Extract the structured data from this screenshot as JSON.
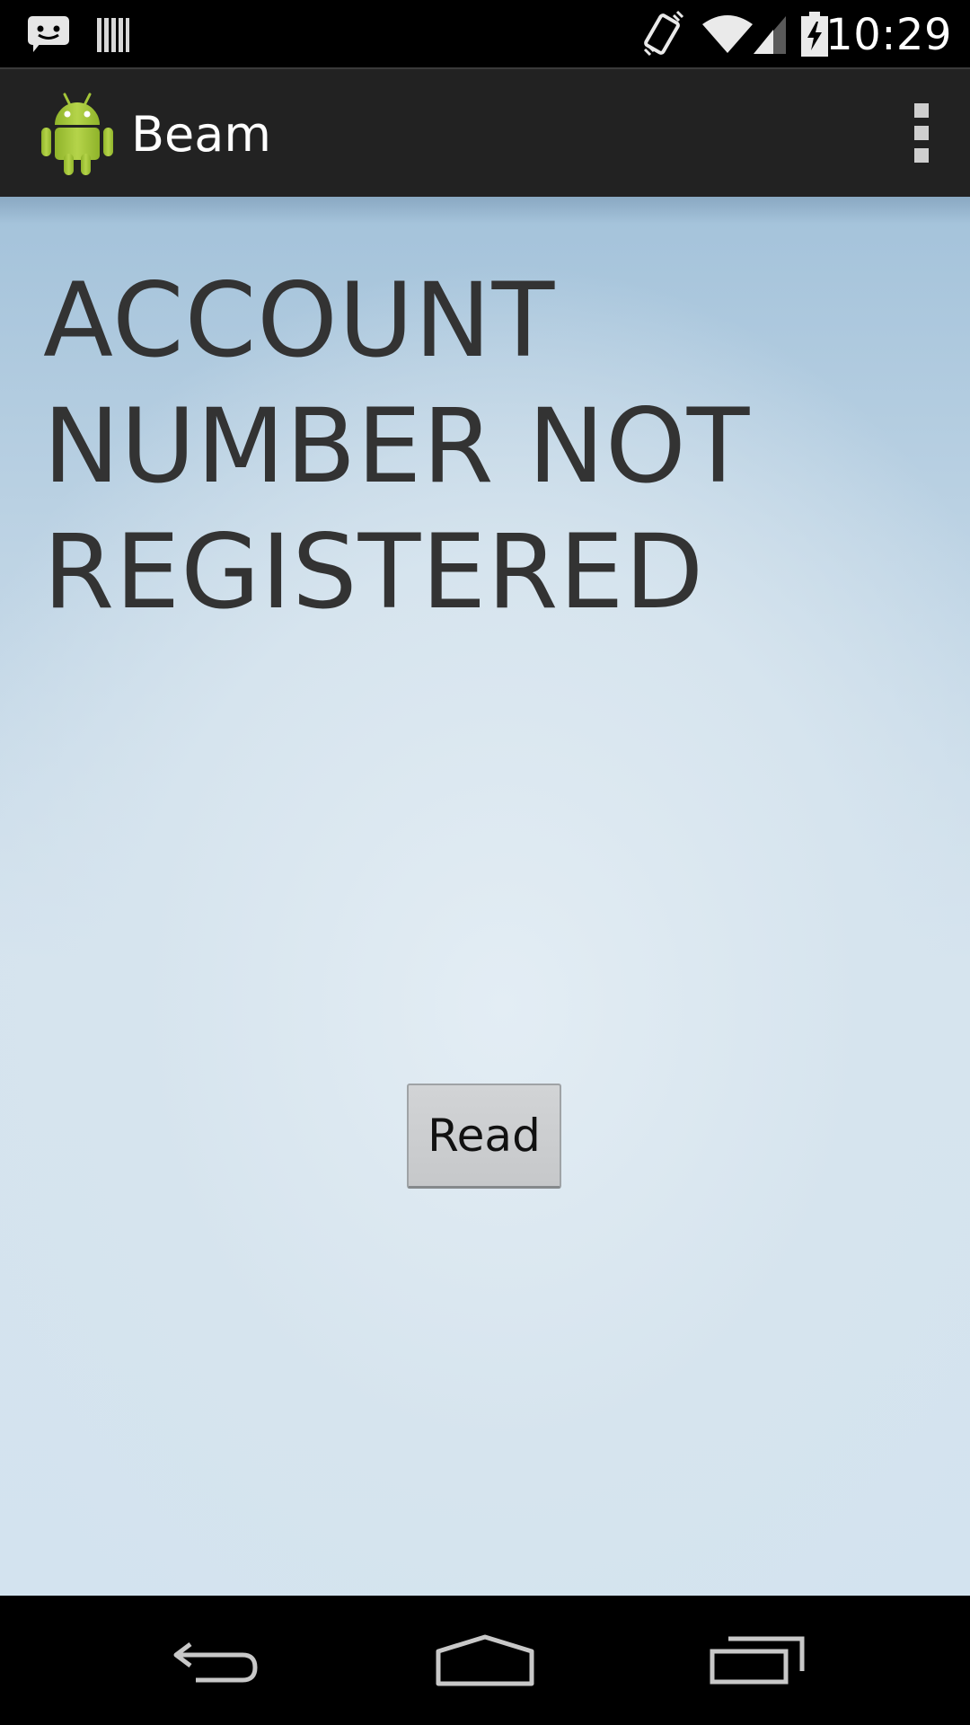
{
  "status_bar": {
    "time": "10:29",
    "icons": {
      "left": [
        "messaging-notification-icon",
        "barcode-notification-icon"
      ],
      "right": [
        "vibrate-icon",
        "wifi-icon",
        "cell-signal-icon",
        "battery-charging-icon"
      ]
    }
  },
  "action_bar": {
    "title": "Beam",
    "app_icon": "android-robot-icon",
    "overflow_icon": "overflow-menu-icon"
  },
  "main": {
    "message": "ACCOUNT NUMBER NOT REGISTERED",
    "read_button_label": "Read"
  },
  "nav_bar": {
    "buttons": [
      "back-icon",
      "home-icon",
      "recent-apps-icon"
    ]
  },
  "colors": {
    "status_bar_bg": "#000000",
    "action_bar_bg": "#222222",
    "text_dark": "#333333",
    "android_green": "#a4c639"
  }
}
